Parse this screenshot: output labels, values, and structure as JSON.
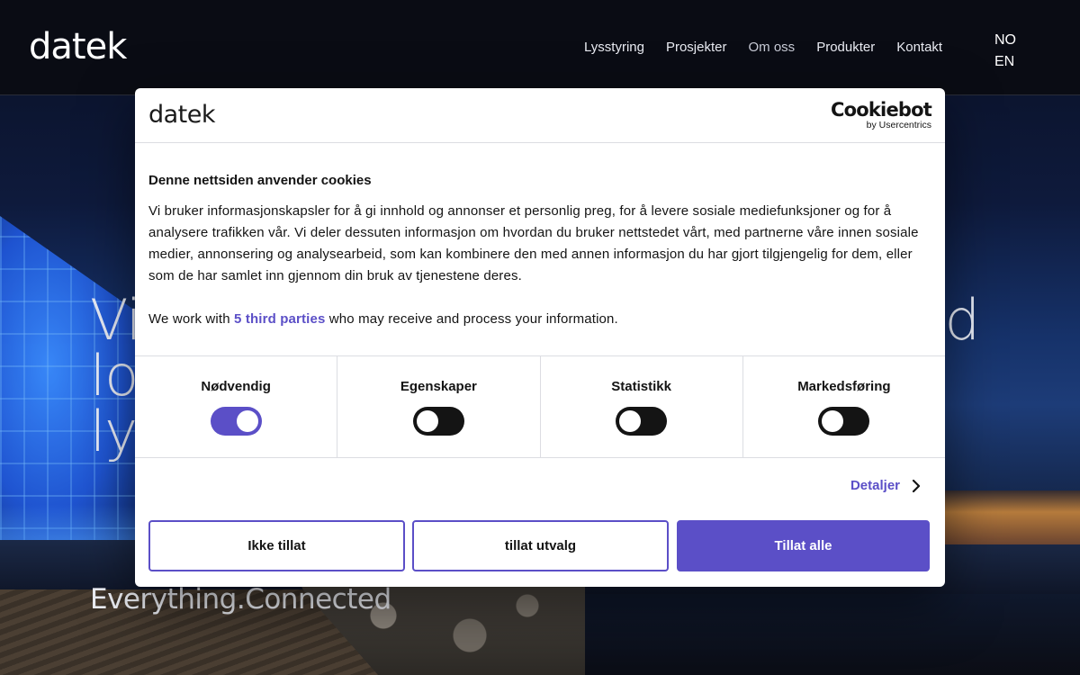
{
  "nav": {
    "logo": "datek",
    "links": [
      "Lysstyring",
      "Prosjekter",
      "Om oss",
      "Produkter",
      "Kontakt"
    ],
    "languages": [
      "NO",
      "EN"
    ]
  },
  "hero": {
    "title_lines": [
      "Vi",
      "lo",
      "lys"
    ],
    "title_right": "d",
    "tagline": "Everything.Connected"
  },
  "cookie_dialog": {
    "logo": "datek",
    "provider_logo": "Cookiebot",
    "provider_sub": "by Usercentrics",
    "title": "Denne nettsiden anvender cookies",
    "body": "Vi bruker informasjonskapsler for å gi innhold og annonser et personlig preg, for å levere sosiale mediefunksjoner og for å analysere trafikken vår. Vi deler dessuten informasjon om hvordan du bruker nettstedet vårt, med partnerne våre innen sosiale medier, annonsering og analysearbeid, som kan kombinere den med annen informasjon du har gjort tilgjengelig for dem, eller som de har samlet inn gjennom din bruk av tjenestene deres.",
    "third_parties_prefix": "We work with ",
    "third_parties_link": "5 third parties",
    "third_parties_suffix": " who may receive and process your information.",
    "categories": [
      {
        "label": "Nødvendig",
        "on": true
      },
      {
        "label": "Egenskaper",
        "on": false
      },
      {
        "label": "Statistikk",
        "on": false
      },
      {
        "label": "Markedsføring",
        "on": false
      }
    ],
    "details_label": "Detaljer",
    "buttons": {
      "deny": "Ikke tillat",
      "selection": "tillat utvalg",
      "allow_all": "Tillat alle"
    },
    "accent_color": "#5b4fc7"
  }
}
